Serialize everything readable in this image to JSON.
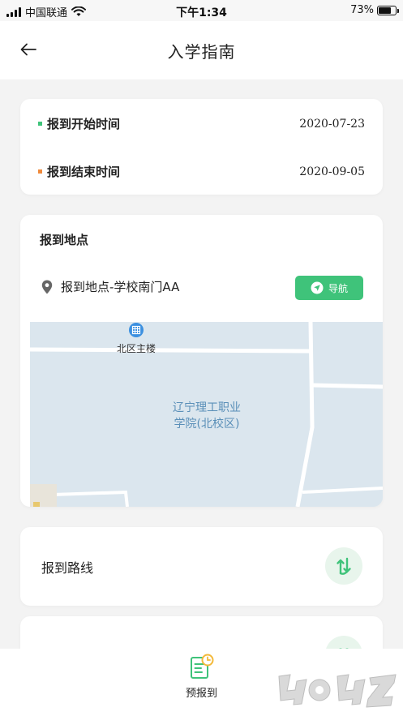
{
  "status_bar": {
    "carrier": "中国联通",
    "time": "下午1:34",
    "battery": "73%",
    "battery_level": 0.73
  },
  "header": {
    "title": "入学指南"
  },
  "schedule": {
    "start_label": "报到开始时间",
    "start_value": "2020-07-23",
    "start_color": "#3fc37a",
    "end_label": "报到结束时间",
    "end_value": "2020-09-05",
    "end_color": "#f08a3c"
  },
  "location": {
    "title": "报到地点",
    "address": "报到地点-学校南门AA",
    "navigate_label": "导航",
    "map": {
      "poi_label": "北区主楼",
      "campus_line1": "辽宁理工职业",
      "campus_line2": "学院(北校区)"
    }
  },
  "route": {
    "label": "报到路线"
  },
  "tab_bar": {
    "pre_register_label": "预报到"
  },
  "watermark": "4U4Z.com",
  "colors": {
    "accent_green": "#3fc37a",
    "map_label_blue": "#5a8fb8"
  },
  "icons": {
    "back": "arrow-left-icon",
    "location": "location-pin-icon",
    "navigate": "compass-arrow-icon",
    "route": "route-arrows-icon",
    "pre_register": "document-clock-icon"
  }
}
